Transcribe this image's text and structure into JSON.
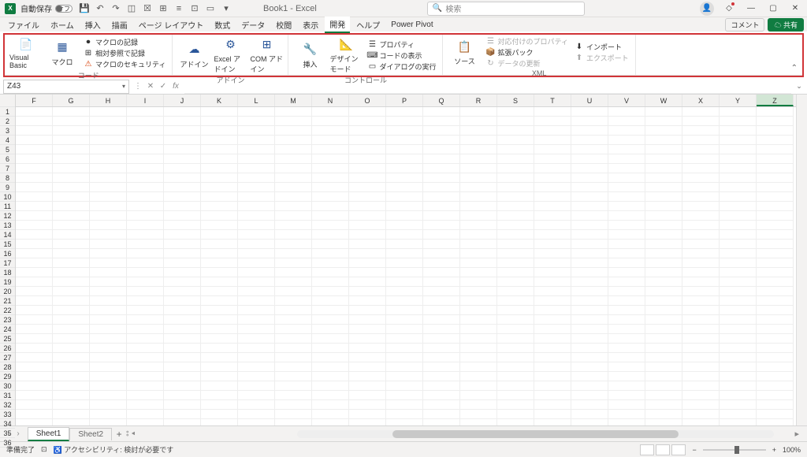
{
  "titlebar": {
    "autosave_label": "自動保存",
    "autosave_state": "オフ",
    "doc_title": "Book1 - Excel",
    "search_placeholder": "検索"
  },
  "tabs": {
    "items": [
      "ファイル",
      "ホーム",
      "挿入",
      "描画",
      "ページ レイアウト",
      "数式",
      "データ",
      "校閲",
      "表示",
      "開発",
      "ヘルプ",
      "Power Pivot"
    ],
    "active_index": 9,
    "comment_label": "コメント",
    "share_label": "共有"
  },
  "ribbon": {
    "groups": [
      {
        "label": "コード",
        "big": [
          {
            "icon": "vb",
            "label": "Visual Basic"
          },
          {
            "icon": "macro",
            "label": "マクロ"
          }
        ],
        "small": [
          {
            "icon": "rec",
            "label": "マクロの記録"
          },
          {
            "icon": "ref",
            "label": "相対参照で記録"
          },
          {
            "icon": "sec",
            "label": "マクロのセキュリティ"
          }
        ]
      },
      {
        "label": "アドイン",
        "big": [
          {
            "icon": "addin",
            "label": "アドイン"
          },
          {
            "icon": "excel-addin",
            "label": "Excel アドイン"
          },
          {
            "icon": "com",
            "label": "COM アドイン"
          }
        ],
        "small": []
      },
      {
        "label": "コントロール",
        "big": [
          {
            "icon": "insert",
            "label": "挿入"
          },
          {
            "icon": "design",
            "label": "デザイン モード"
          }
        ],
        "small": [
          {
            "icon": "prop",
            "label": "プロパティ"
          },
          {
            "icon": "code",
            "label": "コードの表示"
          },
          {
            "icon": "dialog",
            "label": "ダイアログの実行"
          }
        ]
      },
      {
        "label": "XML",
        "big": [
          {
            "icon": "source",
            "label": "ソース"
          }
        ],
        "small_cols": [
          [
            {
              "icon": "mapprop",
              "label": "対応付けのプロパティ",
              "disabled": true
            },
            {
              "icon": "expand",
              "label": "拡張パック"
            },
            {
              "icon": "refresh",
              "label": "データの更新",
              "disabled": true
            }
          ],
          [
            {
              "icon": "import",
              "label": "インポート"
            },
            {
              "icon": "export",
              "label": "エクスポート",
              "disabled": true
            }
          ]
        ]
      }
    ]
  },
  "namebox": {
    "value": "Z43"
  },
  "columns": [
    "F",
    "G",
    "H",
    "I",
    "J",
    "K",
    "L",
    "M",
    "N",
    "O",
    "P",
    "Q",
    "R",
    "S",
    "T",
    "U",
    "V",
    "W",
    "X",
    "Y",
    "Z"
  ],
  "selected_col": "Z",
  "rows_start": 1,
  "rows_end": 36,
  "sheets": {
    "items": [
      "Sheet1",
      "Sheet2"
    ],
    "active_index": 0
  },
  "statusbar": {
    "ready": "準備完了",
    "accessibility": "アクセシビリティ: 検討が必要です",
    "zoom": "100%"
  }
}
